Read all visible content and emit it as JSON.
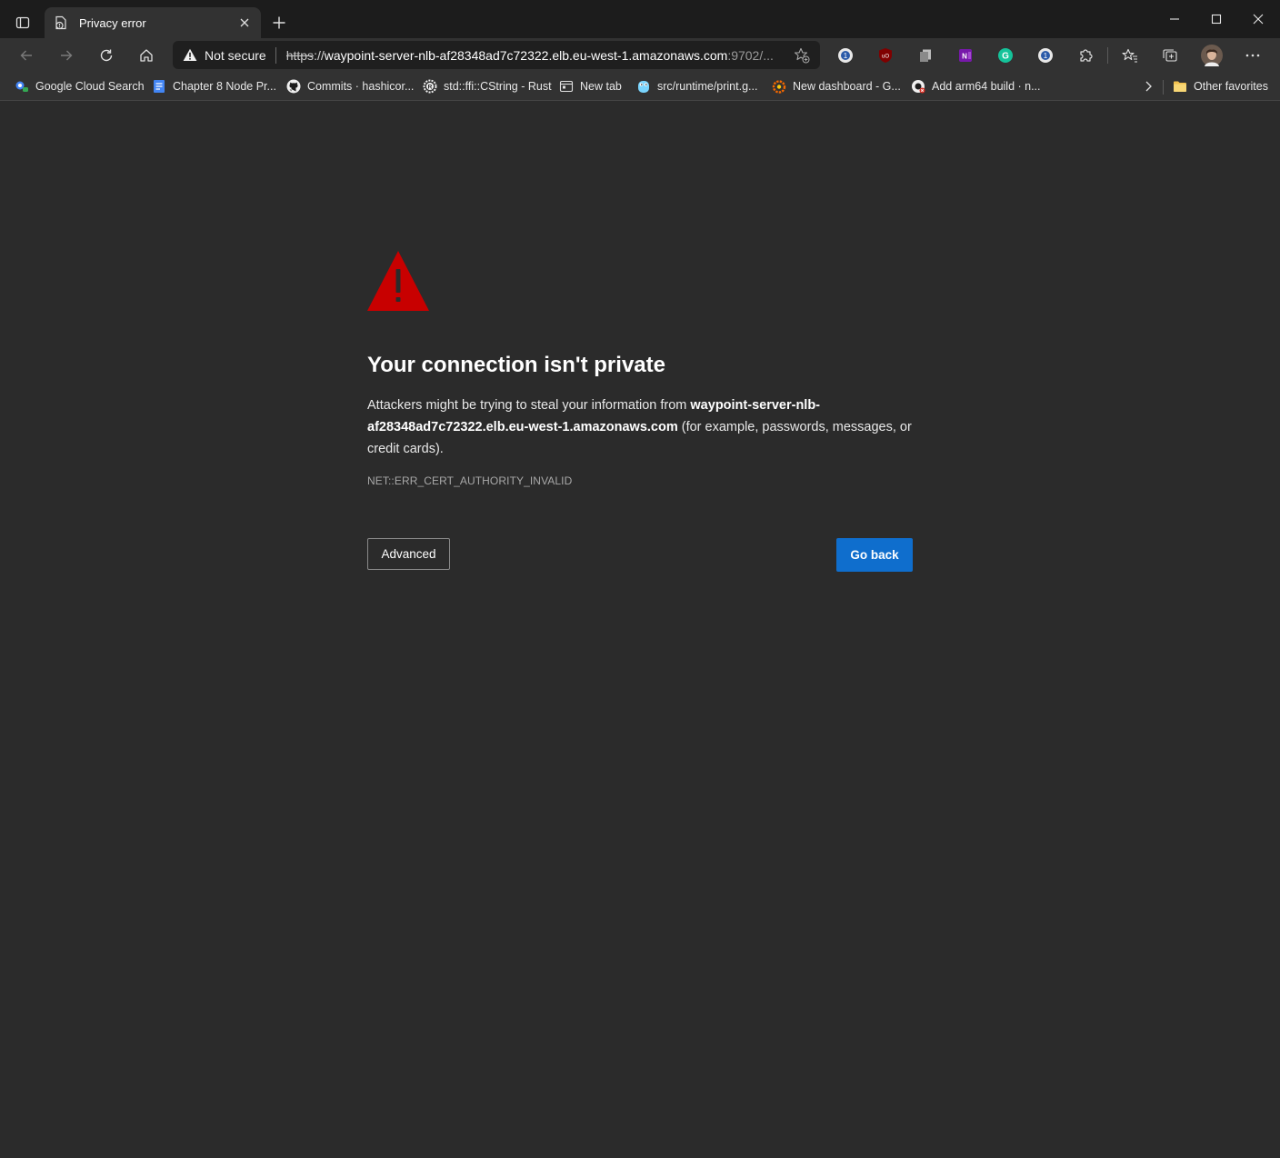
{
  "tab": {
    "title": "Privacy error"
  },
  "omnibox": {
    "security_label": "Not secure",
    "url_scheme": "https",
    "url_sep": "://",
    "url_host": "waypoint-server-nlb-af28348ad7c72322.elb.eu-west-1.amazonaws.com",
    "url_rest": ":9702/..."
  },
  "bookmarks": [
    {
      "label": "Google Cloud Search",
      "icon": "google-cloud-search-icon"
    },
    {
      "label": "Chapter 8 Node Pr...",
      "icon": "google-docs-icon"
    },
    {
      "label": "Commits · hashicor...",
      "icon": "github-icon"
    },
    {
      "label": "std::ffi::CString - Rust",
      "icon": "rust-icon"
    },
    {
      "label": "New tab",
      "icon": "new-tab-icon"
    },
    {
      "label": "src/runtime/print.g...",
      "icon": "go-gopher-icon"
    },
    {
      "label": "New dashboard - G...",
      "icon": "grafana-icon"
    },
    {
      "label": "Add arm64 build · n...",
      "icon": "github-pr-icon"
    }
  ],
  "other_favorites": "Other favorites",
  "page": {
    "heading": "Your connection isn't private",
    "para_before": "Attackers might be trying to steal your information from ",
    "para_host": "waypoint-server-nlb-af28348ad7c72322.elb.eu-west-1.amazonaws.com",
    "para_after": " (for example, passwords, messages, or credit cards).",
    "error_code": "NET::ERR_CERT_AUTHORITY_INVALID",
    "advanced_label": "Advanced",
    "go_back_label": "Go back"
  },
  "colors": {
    "page_bg": "#2b2b2b",
    "warning_red": "#c80000",
    "primary_button": "#0f6ecd"
  }
}
